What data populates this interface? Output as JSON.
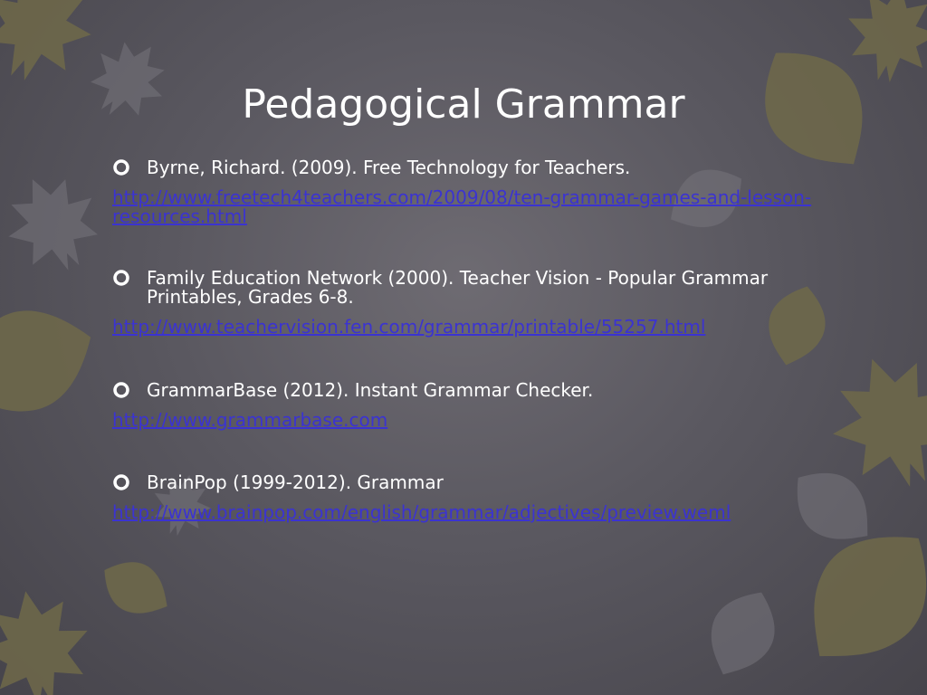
{
  "slide": {
    "title": "Pedagogical Grammar",
    "references": [
      {
        "text": "Byrne, Richard. (2009). Free Technology for Teachers.",
        "link": "http://www.freetech4teachers.com/2009/08/ten-grammar-games-and-lesson-resources.html"
      },
      {
        "text": "Family Education Network (2000).   Teacher Vision - Popular Grammar Printables, Grades 6-8.",
        "link": "http://www.teachervision.fen.com/grammar/printable/55257.html"
      },
      {
        "text": "GrammarBase (2012).  Instant Grammar Checker.",
        "link": "http://www.grammarbase.com"
      },
      {
        "text": "BrainPop (1999-2012).  Grammar",
        "link": "http://www.brainpop.com/english/grammar/adjectives/preview.weml"
      }
    ]
  },
  "colors": {
    "background": "#5a5860",
    "title": "#ffffff",
    "text": "#ffffff",
    "link": "#3b33d1",
    "leaf_olive": "#6f6a4a",
    "leaf_gray": "#77757c"
  },
  "icons": {
    "bullet": "ring-bullet-icon",
    "decor": "autumn-leaf-icon"
  }
}
